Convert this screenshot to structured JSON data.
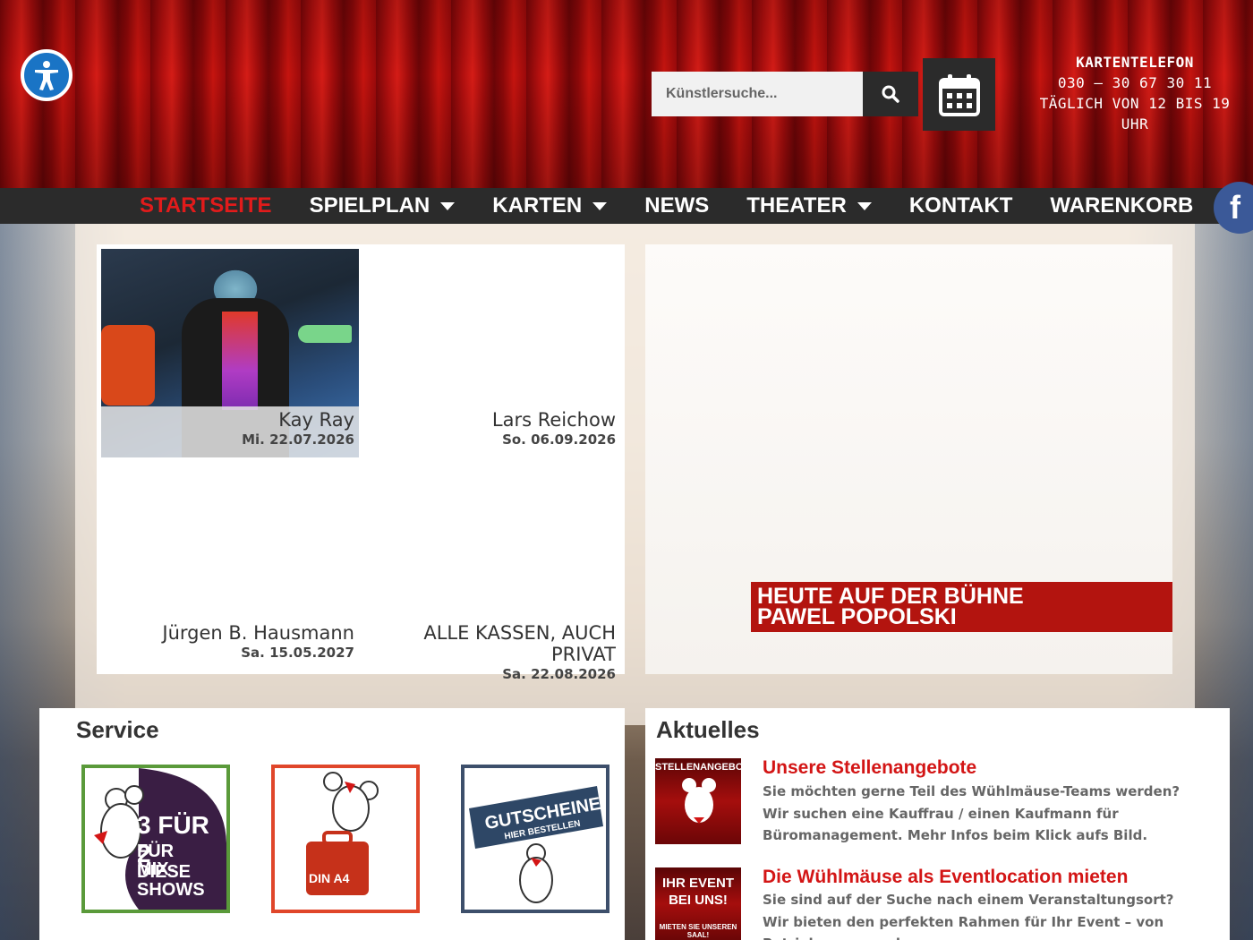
{
  "header": {
    "search_placeholder": "Künstlersuche...",
    "phone_title": "KARTENTELEFON",
    "phone_number": "030 – 30 67 30 11",
    "phone_hours": "TÄGLICH VON 12 BIS 19 UHR"
  },
  "nav": {
    "items": [
      {
        "label": "STARTSEITE",
        "active": true,
        "dropdown": false
      },
      {
        "label": "SPIELPLAN",
        "active": false,
        "dropdown": true
      },
      {
        "label": "KARTEN",
        "active": false,
        "dropdown": true
      },
      {
        "label": "NEWS",
        "active": false,
        "dropdown": false
      },
      {
        "label": "THEATER",
        "active": false,
        "dropdown": true
      },
      {
        "label": "KONTAKT",
        "active": false,
        "dropdown": false
      },
      {
        "label": "WARENKORB",
        "active": false,
        "dropdown": false
      }
    ],
    "facebook_glyph": "f"
  },
  "shows": [
    {
      "name": "Kay Ray",
      "date": "Mi. 22.07.2026"
    },
    {
      "name": "Lars Reichow",
      "date": "So. 06.09.2026"
    },
    {
      "name": "Jürgen B. Hausmann",
      "date": "Sa. 15.05.2027"
    },
    {
      "name": "ALLE KASSEN, AUCH PRIVAT",
      "date": "Sa. 22.08.2026"
    }
  ],
  "today": {
    "line1": "HEUTE AUF DER BÜHNE",
    "line2": "PAWEL POPOLSKI"
  },
  "service": {
    "heading": "Service",
    "tiles": [
      {
        "line1": "3 FÜR 2",
        "line2": "FÜR DIESE",
        "line3": "MIX-SHOWS",
        "border": "#5a9a3a"
      },
      {
        "line1": "DIN A4",
        "border": "#e0462a"
      },
      {
        "line1": "GUTSCHEINE",
        "line2": "HIER BESTELLEN",
        "border": "#3d4f6b"
      }
    ]
  },
  "aktuelles": {
    "heading": "Aktuelles",
    "items": [
      {
        "thumb": "STELLENANGEBOTE",
        "title": "Unsere Stellenangebote",
        "text": "Sie möchten gerne Teil des Wühlmäuse-Teams werden? Wir suchen eine Kauffrau / einen Kaufmann für Büromanagement. Mehr Infos beim Klick aufs Bild."
      },
      {
        "thumb": "IHR EVENT BEI UNS!",
        "thumb_sub": "MIETEN SIE UNSEREN SAAL!",
        "title": "Die Wühlmäuse als Eventlocation mieten",
        "text": "Sie sind auf der Suche nach einem Veranstaltungsort? Wir bieten den perfekten Rahmen für Ihr Event – von Betriebsversammlung"
      }
    ]
  },
  "colors": {
    "accent_red": "#d31515",
    "nav_bg": "#2b2b2b",
    "facebook": "#3b5998",
    "a11y_blue": "#1a74c5"
  }
}
